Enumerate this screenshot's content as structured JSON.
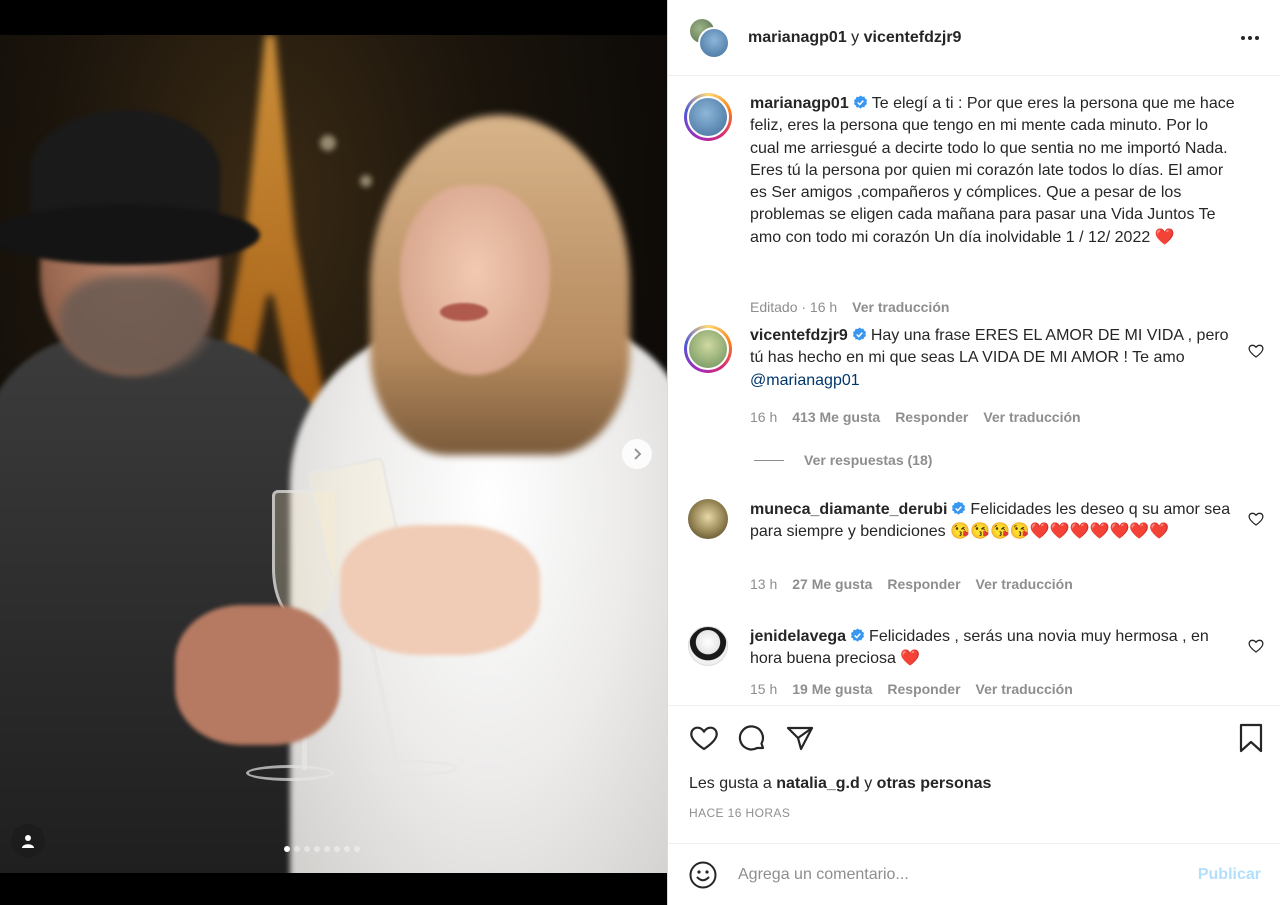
{
  "header": {
    "user1": "marianagp01",
    "connector": "y",
    "user2": "vicentefdzjr9",
    "more_icon": "more-horizontal-icon"
  },
  "caption": {
    "username": "marianagp01",
    "text": "Te elegí a ti : Por que eres la persona que me hace feliz, eres la persona que tengo en mi mente cada minuto. Por lo cual me arriesgué a decirte todo lo que sentia no me importó Nada. Eres tú la persona por quien mi corazón late todos lo días. El amor es Ser amigos ,compañeros y cómplices. Que a pesar de los problemas se eligen cada mañana para pasar una Vida Juntos Te amo con todo mi corazón Un día inolvidable 1 / 12/ 2022 ❤️",
    "edited": "Editado · 16 h",
    "translate": "Ver traducción"
  },
  "comments": [
    {
      "username": "vicentefdzjr9",
      "text": "Hay una frase ERES EL AMOR DE MI VIDA , pero tú has hecho en mi que seas LA VIDA DE MI AMOR ! Te amo ",
      "mention": "@marianagp01",
      "time": "16 h",
      "likes": "413 Me gusta",
      "reply": "Responder",
      "translate": "Ver traducción",
      "view_replies": "Ver respuestas (18)"
    },
    {
      "username": "muneca_diamante_derubi",
      "text": "Felicidades les deseo q su amor sea para siempre y bendiciones 😘😘😘😘❤️❤️❤️❤️❤️❤️❤️",
      "time": "13 h",
      "likes": "27 Me gusta",
      "reply": "Responder",
      "translate": "Ver traducción"
    },
    {
      "username": "jenidelavega",
      "text": "Felicidades , serás una novia muy hermosa , en hora buena preciosa ❤️",
      "time": "15 h",
      "likes": "19 Me gusta",
      "reply": "Responder",
      "translate": "Ver traducción"
    }
  ],
  "likes": {
    "prefix": "Les gusta a",
    "user": "natalia_g.d",
    "connector": "y",
    "others": "otras personas"
  },
  "posted": "HACE 16 HORAS",
  "comment_box": {
    "placeholder": "Agrega un comentario...",
    "publish": "Publicar"
  },
  "carousel": {
    "count": 8,
    "active_index": 0
  },
  "colors": {
    "verified": "#3897f0",
    "publish_disabled": "#b2dffc",
    "muted": "#8e8e8e",
    "mention": "#00376b"
  }
}
